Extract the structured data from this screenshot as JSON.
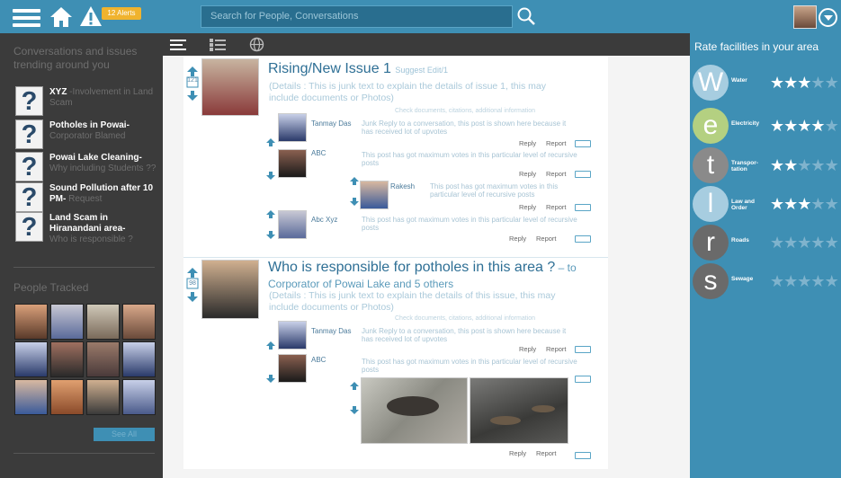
{
  "header": {
    "notif_badge": "12 Alerts",
    "search_placeholder": "Search for People, Conversations"
  },
  "sidebar": {
    "trending_title": "Conversations and issues trending around you",
    "trending": [
      {
        "title": "XYZ",
        "sub": " -Involvement in Land Scam"
      },
      {
        "title": "Potholes in Powai-",
        "sub": "Corporator Blamed"
      },
      {
        "title": "Powai Lake Cleaning-",
        "sub": "Why including Students ??"
      },
      {
        "title": "Sound Pollution after 10 PM-",
        "sub": " Request"
      },
      {
        "title": "Land Scam in Hiranandani area-",
        "sub": "Who is responsible ?"
      }
    ],
    "people_title": "People Tracked",
    "see_all": "See All"
  },
  "feed": {
    "issue1": {
      "title": "Rising/New Issue 1",
      "suggest": "Suggest Edit/1",
      "details": "(Details : This is junk text to explain the details of issue 1, this may include documents or Photos)",
      "attach": "Check documents, citations, additional information",
      "count": "121"
    },
    "issue2": {
      "title": "Who is responsible for potholes in this area ?",
      "to_prefix": " – to",
      "to": "Corporator of Powai Lake and 5 others",
      "details": "(Details : This is junk text to explain the details of this issue, this may include documents or Photos)",
      "attach": "Check documents, citations, additional information",
      "count": "98"
    },
    "names": {
      "tanmay": "Tanmay Das",
      "abc": "ABC",
      "rakesh": "Rakesh",
      "abcxyz": "Abc Xyz"
    },
    "text_junk": "Junk Reply to a conversation, this post is shown here because it has received lot of upvotes",
    "text_max": "This post has got maximum votes in this particular level of recursive posts",
    "reply": "Reply",
    "report": "Report"
  },
  "rating": {
    "title": "Rate facilities in your area",
    "items": [
      {
        "letter": "W",
        "label": "Water",
        "stars": 3,
        "color": "#a7cde0"
      },
      {
        "letter": "e",
        "label": "Electricity",
        "stars": 4,
        "color": "#b4d081"
      },
      {
        "letter": "t",
        "label": "Transpor- tation",
        "stars": 2,
        "color": "#8a8a8a"
      },
      {
        "letter": "l",
        "label": "Law and Order",
        "stars": 3,
        "color": "#a7cde0"
      },
      {
        "letter": "r",
        "label": "Roads",
        "stars": 0,
        "color": "#6a6a6a"
      },
      {
        "letter": "s",
        "label": "Sewage",
        "stars": 0,
        "color": "#6a6a6a"
      }
    ]
  }
}
